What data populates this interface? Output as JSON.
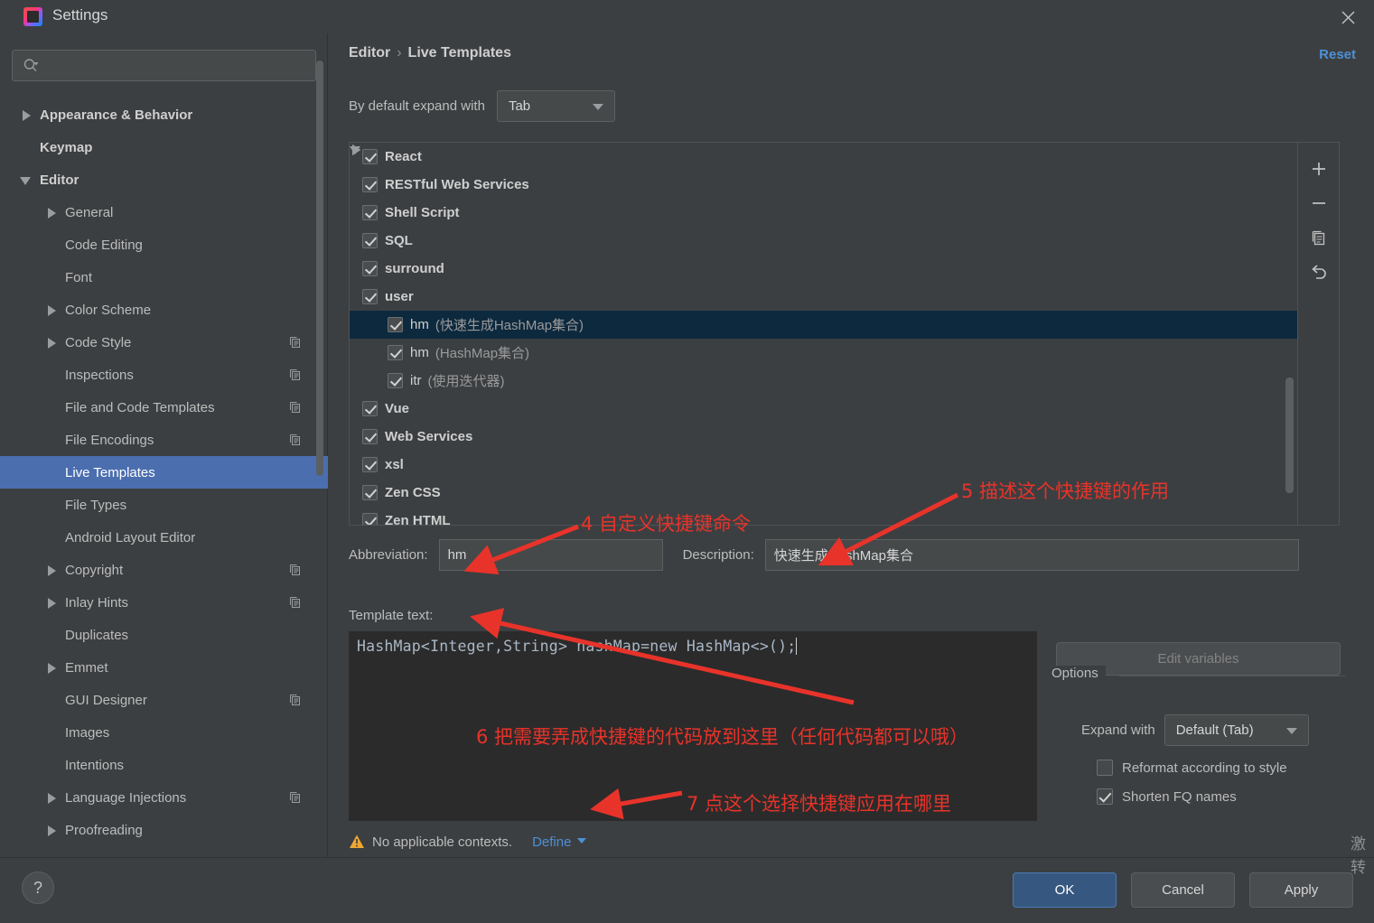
{
  "window": {
    "title": "Settings",
    "close_icon": "close-icon",
    "app_icon": "intellij-idea-icon"
  },
  "sidebar": {
    "search": {
      "placeholder": "",
      "value": "",
      "icon": "search-icon"
    },
    "items": [
      {
        "label": "Appearance & Behavior",
        "indent": 0,
        "arrow": "right",
        "bold": true,
        "copy": false,
        "selected": false
      },
      {
        "label": "Keymap",
        "indent": 0,
        "arrow": "none",
        "bold": true,
        "copy": false,
        "selected": false
      },
      {
        "label": "Editor",
        "indent": 0,
        "arrow": "down",
        "bold": true,
        "copy": false,
        "selected": false
      },
      {
        "label": "General",
        "indent": 1,
        "arrow": "right",
        "bold": false,
        "copy": false,
        "selected": false
      },
      {
        "label": "Code Editing",
        "indent": 1,
        "arrow": "none",
        "bold": false,
        "copy": false,
        "selected": false
      },
      {
        "label": "Font",
        "indent": 1,
        "arrow": "none",
        "bold": false,
        "copy": false,
        "selected": false
      },
      {
        "label": "Color Scheme",
        "indent": 1,
        "arrow": "right",
        "bold": false,
        "copy": false,
        "selected": false
      },
      {
        "label": "Code Style",
        "indent": 1,
        "arrow": "right",
        "bold": false,
        "copy": true,
        "selected": false
      },
      {
        "label": "Inspections",
        "indent": 1,
        "arrow": "none",
        "bold": false,
        "copy": true,
        "selected": false
      },
      {
        "label": "File and Code Templates",
        "indent": 1,
        "arrow": "none",
        "bold": false,
        "copy": true,
        "selected": false
      },
      {
        "label": "File Encodings",
        "indent": 1,
        "arrow": "none",
        "bold": false,
        "copy": true,
        "selected": false
      },
      {
        "label": "Live Templates",
        "indent": 1,
        "arrow": "none",
        "bold": false,
        "copy": false,
        "selected": true
      },
      {
        "label": "File Types",
        "indent": 1,
        "arrow": "none",
        "bold": false,
        "copy": false,
        "selected": false
      },
      {
        "label": "Android Layout Editor",
        "indent": 1,
        "arrow": "none",
        "bold": false,
        "copy": false,
        "selected": false
      },
      {
        "label": "Copyright",
        "indent": 1,
        "arrow": "right",
        "bold": false,
        "copy": true,
        "selected": false
      },
      {
        "label": "Inlay Hints",
        "indent": 1,
        "arrow": "right",
        "bold": false,
        "copy": true,
        "selected": false
      },
      {
        "label": "Duplicates",
        "indent": 1,
        "arrow": "none",
        "bold": false,
        "copy": false,
        "selected": false
      },
      {
        "label": "Emmet",
        "indent": 1,
        "arrow": "right",
        "bold": false,
        "copy": false,
        "selected": false
      },
      {
        "label": "GUI Designer",
        "indent": 1,
        "arrow": "none",
        "bold": false,
        "copy": true,
        "selected": false
      },
      {
        "label": "Images",
        "indent": 1,
        "arrow": "none",
        "bold": false,
        "copy": false,
        "selected": false
      },
      {
        "label": "Intentions",
        "indent": 1,
        "arrow": "none",
        "bold": false,
        "copy": false,
        "selected": false
      },
      {
        "label": "Language Injections",
        "indent": 1,
        "arrow": "right",
        "bold": false,
        "copy": true,
        "selected": false
      },
      {
        "label": "Proofreading",
        "indent": 1,
        "arrow": "right",
        "bold": false,
        "copy": false,
        "selected": false
      }
    ]
  },
  "main": {
    "breadcrumb": {
      "root": "Editor",
      "separator": "›",
      "leaf": "Live Templates"
    },
    "reset_label": "Reset",
    "expand_default": {
      "label": "By default expand with",
      "value": "Tab"
    },
    "template_groups": [
      {
        "name": "React",
        "desc": "",
        "indent": 1,
        "arrow": "right",
        "checked": true,
        "bold": true,
        "selected": false
      },
      {
        "name": "RESTful Web Services",
        "desc": "",
        "indent": 1,
        "arrow": "right",
        "checked": true,
        "bold": true,
        "selected": false
      },
      {
        "name": "Shell Script",
        "desc": "",
        "indent": 1,
        "arrow": "right",
        "checked": true,
        "bold": true,
        "selected": false
      },
      {
        "name": "SQL",
        "desc": "",
        "indent": 1,
        "arrow": "right",
        "checked": true,
        "bold": true,
        "selected": false
      },
      {
        "name": "surround",
        "desc": "",
        "indent": 1,
        "arrow": "right",
        "checked": true,
        "bold": true,
        "selected": false
      },
      {
        "name": "user",
        "desc": "",
        "indent": 1,
        "arrow": "down",
        "checked": true,
        "bold": true,
        "selected": false
      },
      {
        "name": "hm",
        "desc": "(快速生成HashMap集合)",
        "indent": 2,
        "arrow": "none",
        "checked": true,
        "bold": false,
        "selected": true
      },
      {
        "name": "hm",
        "desc": "(HashMap集合)",
        "indent": 2,
        "arrow": "none",
        "checked": true,
        "bold": false,
        "selected": false
      },
      {
        "name": "itr",
        "desc": "(使用迭代器)",
        "indent": 2,
        "arrow": "none",
        "checked": true,
        "bold": false,
        "selected": false
      },
      {
        "name": "Vue",
        "desc": "",
        "indent": 1,
        "arrow": "right",
        "checked": true,
        "bold": true,
        "selected": false
      },
      {
        "name": "Web Services",
        "desc": "",
        "indent": 1,
        "arrow": "right",
        "checked": true,
        "bold": true,
        "selected": false
      },
      {
        "name": "xsl",
        "desc": "",
        "indent": 1,
        "arrow": "right",
        "checked": true,
        "bold": true,
        "selected": false
      },
      {
        "name": "Zen CSS",
        "desc": "",
        "indent": 1,
        "arrow": "right",
        "checked": true,
        "bold": true,
        "selected": false
      },
      {
        "name": "Zen HTML",
        "desc": "",
        "indent": 1,
        "arrow": "right",
        "checked": true,
        "bold": true,
        "selected": false
      }
    ],
    "list_toolbar": [
      {
        "icon": "plus-icon",
        "glyph": "+"
      },
      {
        "icon": "minus-icon",
        "glyph": "−"
      },
      {
        "icon": "copy-icon",
        "glyph": ""
      },
      {
        "icon": "revert-icon",
        "glyph": ""
      }
    ],
    "abbreviation": {
      "label": "Abbreviation:",
      "value": "hm"
    },
    "description": {
      "label": "Description:",
      "value": "快速生成HashMap集合"
    },
    "template_text": {
      "label": "Template text:",
      "value": "HashMap<Integer,String> hashMap=new HashMap<>();"
    },
    "context": {
      "warning_icon": "warning-triangle-icon",
      "message": "No applicable contexts.",
      "define_label": "Define"
    },
    "edit_variables_label": "Edit variables",
    "options": {
      "legend": "Options",
      "expand_with": {
        "label": "Expand with",
        "value": "Default (Tab)"
      },
      "checkboxes": [
        {
          "label": "Reformat according to style",
          "checked": false
        },
        {
          "label": "Shorten FQ names",
          "checked": true
        }
      ]
    }
  },
  "annotations": [
    {
      "id": "anno-4",
      "text": "4  自定义快捷键命令"
    },
    {
      "id": "anno-5",
      "text": "5  描述这个快捷键的作用"
    },
    {
      "id": "anno-6",
      "text": "6  把需要弄成快捷键的代码放到这里（任何代码都可以哦）"
    },
    {
      "id": "anno-7",
      "text": "7  点这个选择快捷键应用在哪里"
    }
  ],
  "footer": {
    "help_label": "?",
    "ok_label": "OK",
    "cancel_label": "Cancel",
    "apply_label": "Apply"
  },
  "watermark": {
    "line1": "激",
    "line2": "转"
  },
  "colors": {
    "accent_blue": "#4d90d6",
    "selection_blue": "#4b6eaf",
    "list_selection": "#0d293e",
    "annotation_red": "#e8332a",
    "panel_bg": "#3c3f41",
    "editor_bg": "#2b2b2b"
  }
}
